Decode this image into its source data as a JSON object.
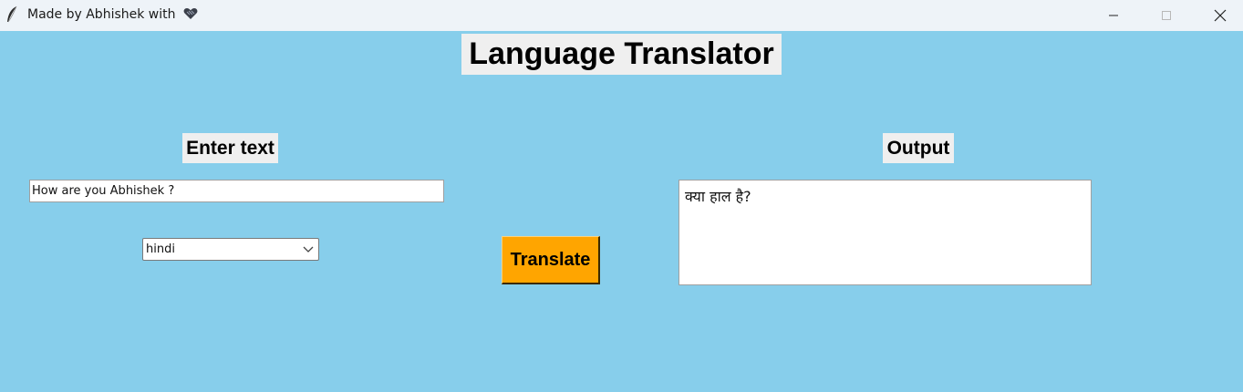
{
  "window": {
    "title": "Made by Abhishek with",
    "background_color": "#87ceeb",
    "icons": {
      "app": "feather-icon",
      "title_suffix": "heart-icon",
      "minimize": "minimize-icon",
      "maximize": "maximize-icon",
      "close": "close-icon"
    }
  },
  "main": {
    "title": "Language Translator",
    "input_label": "Enter text",
    "input_value": "How are you Abhishek ?",
    "language_selected": "hindi",
    "translate_label": "Translate",
    "translate_color": "#ffa500",
    "output_label": "Output",
    "output_value": "क्या हाल है?"
  }
}
